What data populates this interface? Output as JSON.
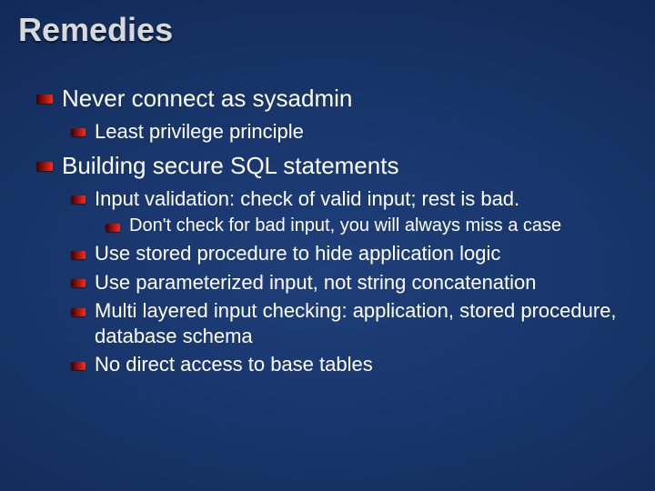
{
  "title": "Remedies",
  "items": [
    {
      "level": 1,
      "text": "Never connect as sysadmin"
    },
    {
      "level": 2,
      "text": "Least privilege principle"
    },
    {
      "level": 1,
      "text": "Building secure SQL statements"
    },
    {
      "level": 2,
      "text": "Input validation: check of valid input; rest is bad."
    },
    {
      "level": 3,
      "text": "Don't check for bad input, you will always miss a case"
    },
    {
      "level": 2,
      "text": "Use stored procedure to hide application logic"
    },
    {
      "level": 2,
      "text": "Use parameterized input, not string concatenation"
    },
    {
      "level": 2,
      "text": "Multi layered input checking: application, stored procedure, database schema"
    },
    {
      "level": 2,
      "text": "No direct access to base tables"
    }
  ]
}
